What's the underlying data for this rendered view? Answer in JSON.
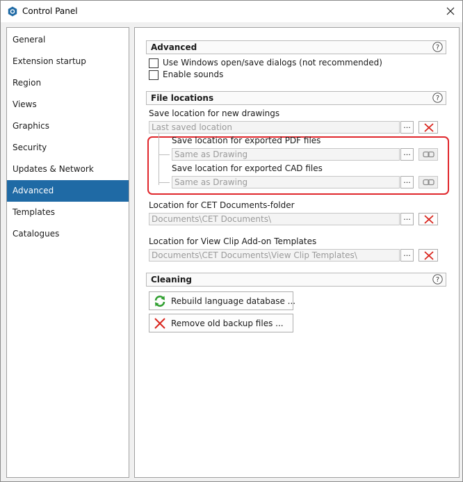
{
  "window": {
    "title": "Control Panel"
  },
  "sidebar": {
    "items": [
      {
        "label": "General"
      },
      {
        "label": "Extension startup"
      },
      {
        "label": "Region"
      },
      {
        "label": "Views"
      },
      {
        "label": "Graphics"
      },
      {
        "label": "Security"
      },
      {
        "label": "Updates & Network"
      },
      {
        "label": "Advanced",
        "selected": true
      },
      {
        "label": "Templates"
      },
      {
        "label": "Catalogues"
      }
    ]
  },
  "advanced": {
    "header": "Advanced",
    "options": [
      {
        "label": "Use Windows open/save dialogs (not recommended)",
        "checked": false
      },
      {
        "label": "Enable sounds",
        "checked": false
      }
    ]
  },
  "file_locations": {
    "header": "File locations",
    "new_drawings": {
      "label": "Save location for new drawings",
      "value": "Last saved location"
    },
    "pdf": {
      "label": "Save location for exported PDF files",
      "value": "Same as Drawing"
    },
    "cad": {
      "label": "Save location for exported CAD files",
      "value": "Same as Drawing"
    },
    "cet_docs": {
      "label": "Location for CET Documents-folder",
      "value": "Documents\\CET Documents\\"
    },
    "view_clip": {
      "label": "Location for View Clip Add-on Templates",
      "value": "Documents\\CET Documents\\View Clip Templates\\"
    },
    "browse_label": "..."
  },
  "cleaning": {
    "header": "Cleaning",
    "rebuild_label": "Rebuild language database ...",
    "remove_label": "Remove old backup files ..."
  },
  "colors": {
    "accent": "#1f6aa5",
    "highlight": "#e0262b",
    "delete": "#d9241c",
    "refresh": "#2e9e2e"
  },
  "icons": [
    "app-icon",
    "close-icon",
    "help-icon",
    "delete-icon",
    "link-icon",
    "refresh-icon"
  ]
}
